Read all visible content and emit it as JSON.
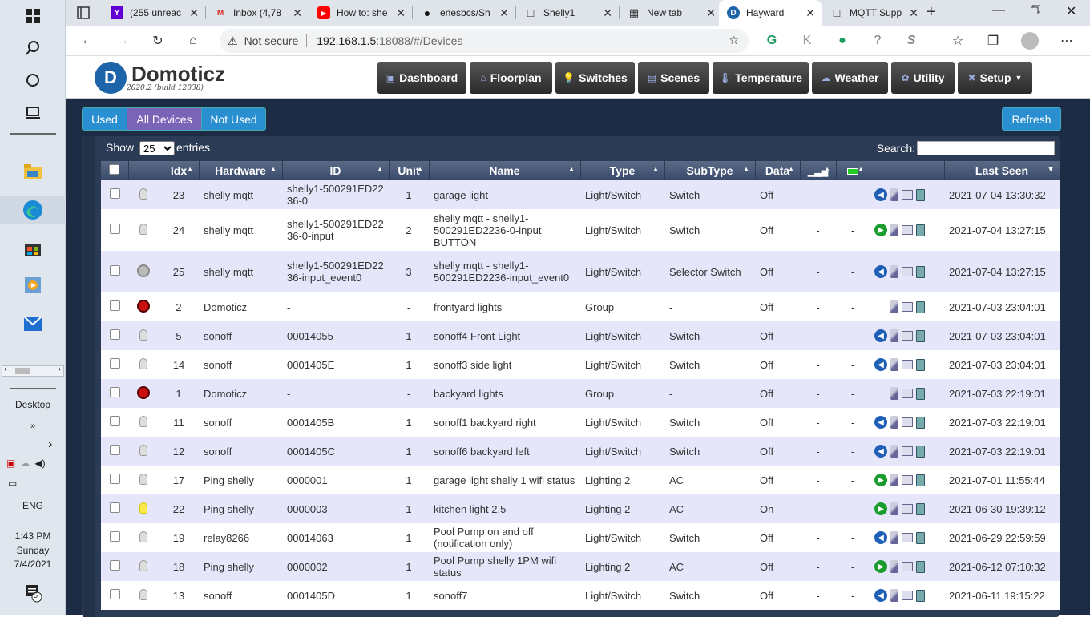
{
  "taskbar": {
    "desktop": "Desktop",
    "chev": "»",
    "lang": "ENG",
    "time": "1:43 PM",
    "day": "Sunday",
    "date": "7/4/2021",
    "notif_count": "5"
  },
  "browser": {
    "tabs": [
      {
        "title": "(255 unreac",
        "fav": "Y"
      },
      {
        "title": "Inbox (4,78",
        "fav": "M"
      },
      {
        "title": "How to: she",
        "fav": "▶"
      },
      {
        "title": "enesbcs/Sh",
        "fav": "●"
      },
      {
        "title": "Shelly1",
        "fav": "□"
      },
      {
        "title": "New tab",
        "fav": "▦"
      },
      {
        "title": "Hayward",
        "fav": "D"
      },
      {
        "title": "MQTT Supp",
        "fav": "□"
      }
    ],
    "not_secure": "Not secure",
    "url_host": "192.168.1.5",
    "url_rest": ":18088/#/Devices"
  },
  "app": {
    "logo": "Domoticz",
    "version": "2020.2 (build 12038)",
    "nav": [
      {
        "label": "Dashboard",
        "icon": "▣"
      },
      {
        "label": "Floorplan",
        "icon": "⌂"
      },
      {
        "label": "Switches",
        "icon": "💡"
      },
      {
        "label": "Scenes",
        "icon": "▤"
      },
      {
        "label": "Temperature",
        "icon": "🌡"
      },
      {
        "label": "Weather",
        "icon": "☁"
      },
      {
        "label": "Utility",
        "icon": "✿"
      },
      {
        "label": "Setup",
        "icon": "✖"
      }
    ],
    "filters": [
      "Used",
      "All Devices",
      "Not Used"
    ],
    "refresh": "Refresh",
    "show": "Show",
    "show_value": "25",
    "entries": "entries",
    "search": "Search:"
  },
  "table": {
    "headers": [
      "Idx",
      "Hardware",
      "ID",
      "Unit",
      "Name",
      "Type",
      "SubType",
      "Data",
      "Last Seen"
    ],
    "rows": [
      {
        "icon": "bulb",
        "idx": "23",
        "hw": "shelly mqtt",
        "id": "shelly1-500291ED2236-0",
        "unit": "1",
        "name": "garage light",
        "type": "Light/Switch",
        "sub": "Switch",
        "data": "Off",
        "s": "-",
        "b": "-",
        "log": "b",
        "seen": "2021-07-04 13:30:32"
      },
      {
        "icon": "bulb",
        "idx": "24",
        "hw": "shelly mqtt",
        "id": "shelly1-500291ED2236-0-input",
        "unit": "2",
        "name": "shelly mqtt - shelly1-500291ED2236-0-input BUTTON",
        "type": "Light/Switch",
        "sub": "Switch",
        "data": "Off",
        "s": "-",
        "b": "-",
        "log": "g",
        "seen": "2021-07-04 13:27:15"
      },
      {
        "icon": "sel",
        "idx": "25",
        "hw": "shelly mqtt",
        "id": "shelly1-500291ED2236-input_event0",
        "unit": "3",
        "name": "shelly mqtt - shelly1-500291ED2236-input_event0",
        "type": "Light/Switch",
        "sub": "Selector Switch",
        "data": "Off",
        "s": "-",
        "b": "-",
        "log": "b",
        "seen": "2021-07-04 13:27:15"
      },
      {
        "icon": "grp",
        "idx": "2",
        "hw": "Domoticz",
        "id": "-",
        "unit": "-",
        "name": "frontyard lights",
        "type": "Group",
        "sub": "-",
        "data": "Off",
        "s": "-",
        "b": "-",
        "log": "",
        "seen": "2021-07-03 23:04:01"
      },
      {
        "icon": "bulb",
        "idx": "5",
        "hw": "sonoff",
        "id": "00014055",
        "unit": "1",
        "name": "sonoff4 Front Light",
        "type": "Light/Switch",
        "sub": "Switch",
        "data": "Off",
        "s": "-",
        "b": "-",
        "log": "b",
        "seen": "2021-07-03 23:04:01"
      },
      {
        "icon": "bulb",
        "idx": "14",
        "hw": "sonoff",
        "id": "0001405E",
        "unit": "1",
        "name": "sonoff3 side light",
        "type": "Light/Switch",
        "sub": "Switch",
        "data": "Off",
        "s": "-",
        "b": "-",
        "log": "b",
        "seen": "2021-07-03 23:04:01"
      },
      {
        "icon": "grp",
        "idx": "1",
        "hw": "Domoticz",
        "id": "-",
        "unit": "-",
        "name": "backyard lights",
        "type": "Group",
        "sub": "-",
        "data": "Off",
        "s": "-",
        "b": "-",
        "log": "",
        "seen": "2021-07-03 22:19:01"
      },
      {
        "icon": "bulb",
        "idx": "11",
        "hw": "sonoff",
        "id": "0001405B",
        "unit": "1",
        "name": "sonoff1 backyard right",
        "type": "Light/Switch",
        "sub": "Switch",
        "data": "Off",
        "s": "-",
        "b": "-",
        "log": "b",
        "seen": "2021-07-03 22:19:01"
      },
      {
        "icon": "bulb",
        "idx": "12",
        "hw": "sonoff",
        "id": "0001405C",
        "unit": "1",
        "name": "sonoff6 backyard left",
        "type": "Light/Switch",
        "sub": "Switch",
        "data": "Off",
        "s": "-",
        "b": "-",
        "log": "b",
        "seen": "2021-07-03 22:19:01"
      },
      {
        "icon": "bulb",
        "idx": "17",
        "hw": "Ping shelly",
        "id": "0000001",
        "unit": "1",
        "name": "garage light shelly 1 wifi status",
        "type": "Lighting 2",
        "sub": "AC",
        "data": "Off",
        "s": "-",
        "b": "-",
        "log": "g",
        "seen": "2021-07-01 11:55:44"
      },
      {
        "icon": "bulbon",
        "idx": "22",
        "hw": "Ping shelly",
        "id": "0000003",
        "unit": "1",
        "name": "kitchen light 2.5",
        "type": "Lighting 2",
        "sub": "AC",
        "data": "On",
        "s": "-",
        "b": "-",
        "log": "g",
        "seen": "2021-06-30 19:39:12"
      },
      {
        "icon": "bulb",
        "idx": "19",
        "hw": "relay8266",
        "id": "00014063",
        "unit": "1",
        "name": "Pool Pump on and off (notification only)",
        "type": "Light/Switch",
        "sub": "Switch",
        "data": "Off",
        "s": "-",
        "b": "-",
        "log": "b",
        "seen": "2021-06-29 22:59:59"
      },
      {
        "icon": "bulb",
        "idx": "18",
        "hw": "Ping shelly",
        "id": "0000002",
        "unit": "1",
        "name": "Pool Pump shelly 1PM wifi status",
        "type": "Lighting 2",
        "sub": "AC",
        "data": "Off",
        "s": "-",
        "b": "-",
        "log": "g",
        "seen": "2021-06-12 07:10:32"
      },
      {
        "icon": "bulb",
        "idx": "13",
        "hw": "sonoff",
        "id": "0001405D",
        "unit": "1",
        "name": "sonoff7",
        "type": "Light/Switch",
        "sub": "Switch",
        "data": "Off",
        "s": "-",
        "b": "-",
        "log": "b",
        "seen": "2021-06-11 19:15:22"
      }
    ]
  }
}
